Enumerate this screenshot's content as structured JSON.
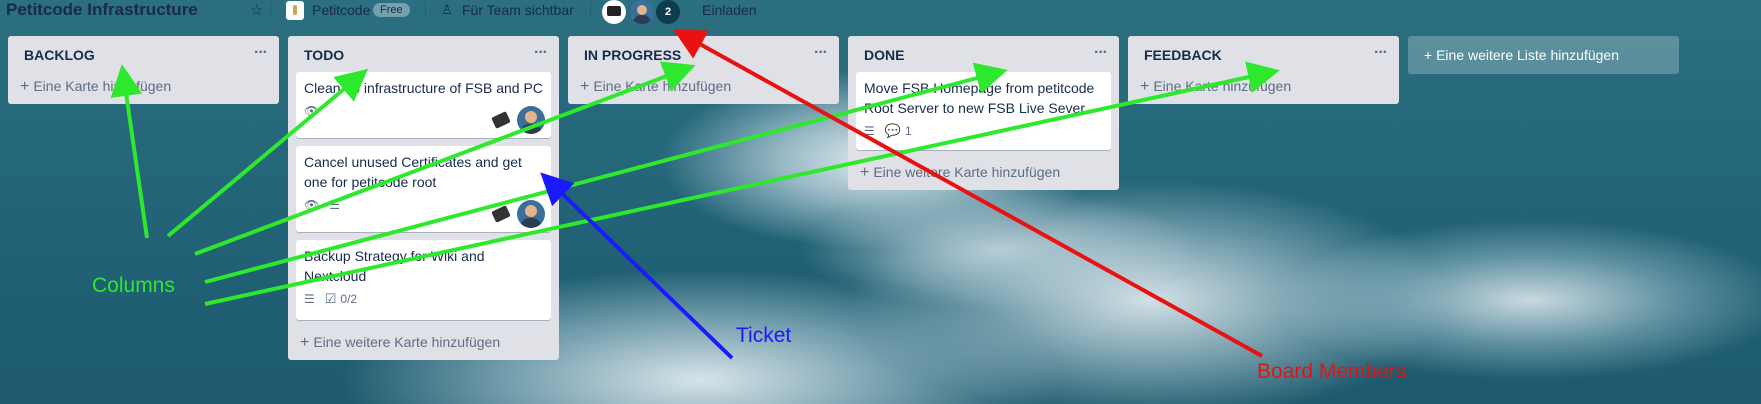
{
  "header": {
    "board_title": "Petitcode Infrastructure",
    "star_icon": "star-icon",
    "team_name": "Petitcode",
    "plan_badge": "Free",
    "visibility": "Für Team sichtbar",
    "member_count": "2",
    "invite": "Einladen"
  },
  "lists": [
    {
      "title": "BACKLOG",
      "menu": "···",
      "add_card": "Eine Karte hinzufügen",
      "cards": []
    },
    {
      "title": "TODO",
      "menu": "···",
      "add_card": "Eine weitere Karte hinzufügen",
      "cards": [
        {
          "title": "Clean up infrastructure of FSB and PC",
          "watching": true
        },
        {
          "title": "Cancel unused Certificates and get one for petitcode root",
          "watching": true,
          "description": true
        },
        {
          "title": "Backup Strategy for Wiki and Nextcloud",
          "description": true,
          "checklist": "0/2"
        }
      ]
    },
    {
      "title": "IN PROGRESS",
      "menu": "···",
      "add_card": "Eine Karte hinzufügen",
      "cards": []
    },
    {
      "title": "DONE",
      "menu": "···",
      "add_card": "Eine weitere Karte hinzufügen",
      "cards": [
        {
          "title": "Move FSB Homepage from petitcode Root Server to new FSB Live Sever",
          "description": true,
          "comments": "1"
        }
      ]
    },
    {
      "title": "FEEDBACK",
      "menu": "···",
      "add_card": "Eine Karte hinzufügen",
      "cards": []
    }
  ],
  "add_list": "Eine weitere Liste hinzufügen",
  "annotations": {
    "columns": "Columns",
    "ticket": "Ticket",
    "board_members": "Board Members"
  },
  "colors": {
    "columns": "#2ee82e",
    "ticket": "#1a1aff",
    "board_members": "#e81212"
  }
}
